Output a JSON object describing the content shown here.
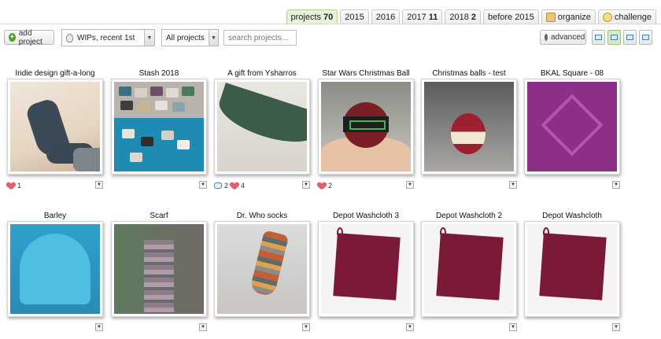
{
  "tabs": [
    {
      "label": "projects",
      "count": "70",
      "active": true
    },
    {
      "label": "2015",
      "count": ""
    },
    {
      "label": "2016",
      "count": ""
    },
    {
      "label": "2017",
      "count": "11"
    },
    {
      "label": "2018",
      "count": "2"
    },
    {
      "label": "before 2015",
      "count": ""
    },
    {
      "label": "organize",
      "icon": "organize-icon"
    },
    {
      "label": "challenge",
      "icon": "challenge-icon"
    }
  ],
  "toolbar": {
    "add_label": "add project",
    "sort_value": "WIPs, recent 1st",
    "filter_value": "All projects",
    "search_placeholder": "search projects...",
    "advanced_label": "advanced",
    "views": [
      "large-grid-view-icon",
      "grid-view-icon",
      "list-view-icon",
      "detail-view-icon"
    ]
  },
  "projects": [
    {
      "title": "Indie design gift-a-long",
      "hearts": "1",
      "comments": ""
    },
    {
      "title": "Stash 2018",
      "hearts": "",
      "comments": ""
    },
    {
      "title": "A gift from Ysharros",
      "hearts": "4",
      "comments": "2"
    },
    {
      "title": "Star Wars Christmas Ball",
      "hearts": "2",
      "comments": ""
    },
    {
      "title": "Christmas balls - test",
      "hearts": "",
      "comments": ""
    },
    {
      "title": "BKAL Square - 08",
      "hearts": "",
      "comments": ""
    },
    {
      "title": "Barley",
      "hearts": "",
      "comments": ""
    },
    {
      "title": "Scarf",
      "hearts": "",
      "comments": ""
    },
    {
      "title": "Dr. Who socks",
      "hearts": "",
      "comments": ""
    },
    {
      "title": "Depot Washcloth 3",
      "hearts": "",
      "comments": ""
    },
    {
      "title": "Depot Washcloth 2",
      "hearts": "",
      "comments": ""
    },
    {
      "title": "Depot Washcloth",
      "hearts": "",
      "comments": ""
    }
  ]
}
